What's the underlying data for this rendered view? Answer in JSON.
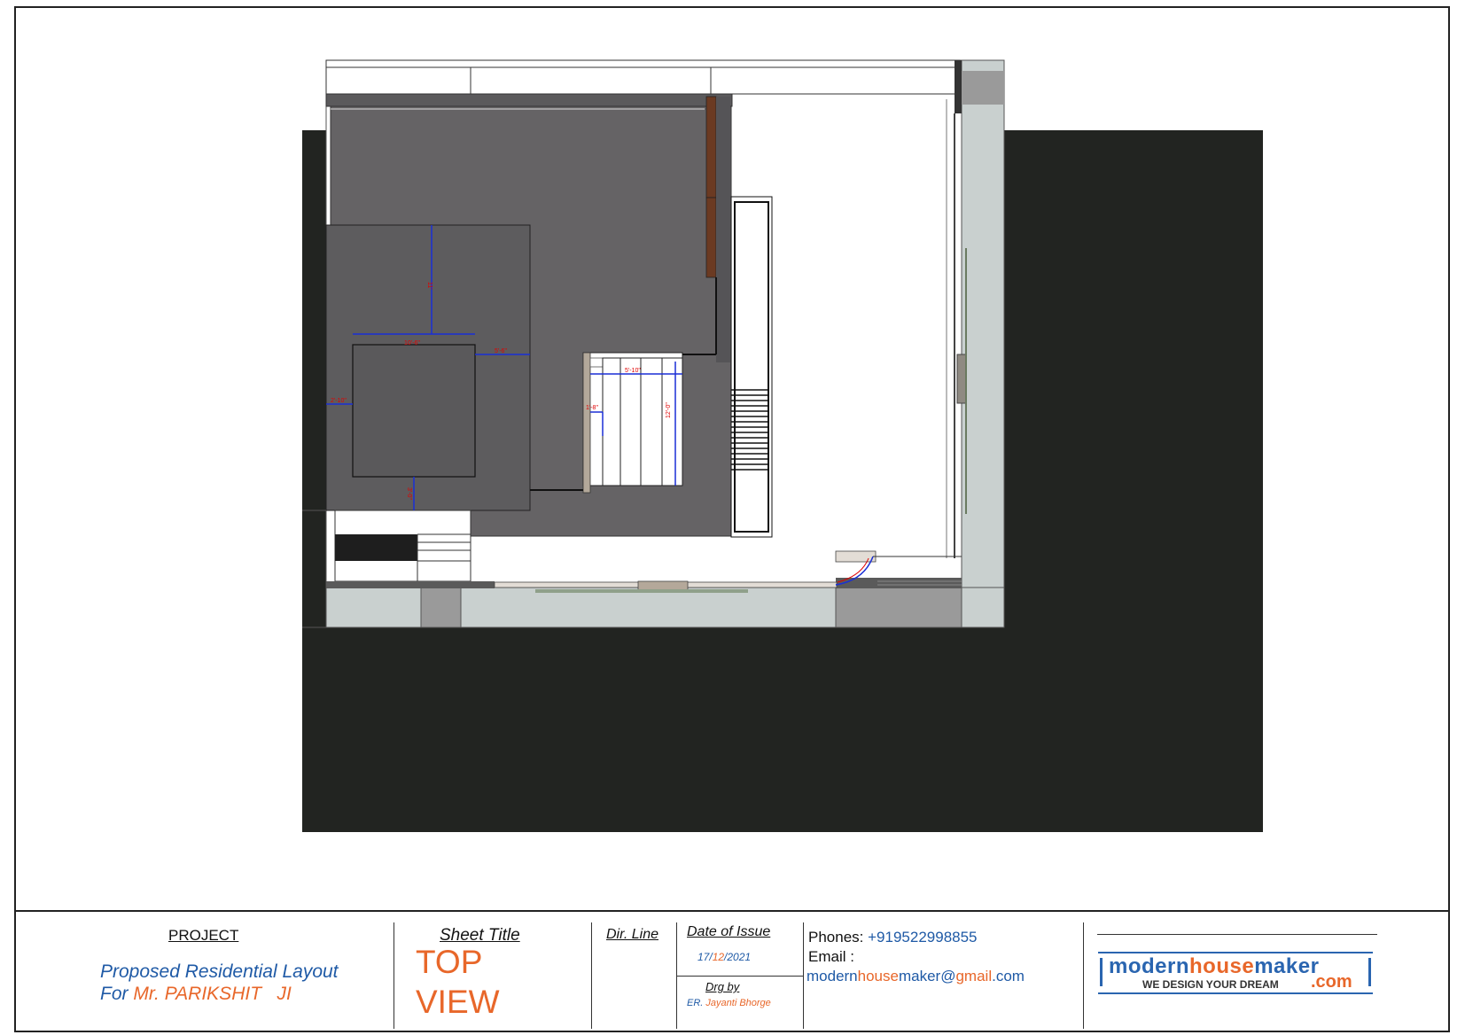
{
  "drawing": {
    "dimensions": {
      "d1": "11'",
      "d2": "10'-6\"",
      "d3": "5'-6\"",
      "d4": "2'-10\"",
      "d5": "3'-0\"",
      "d6": "5'-10\"",
      "d7": "1'-8\"",
      "d8": "12'-0\""
    },
    "colors": {
      "background_block": "#222421",
      "roof": "#656365",
      "wall": "#c9d0cf",
      "wall_dark": "#9a9a9a",
      "wood": "#6b3a22",
      "dimension_line": "#1a2fd6",
      "dimension_text": "#e00000"
    }
  },
  "title_block": {
    "project_label": "PROJECT",
    "project_line1": "Proposed Residential Layout",
    "project_line2_prefix": "For",
    "project_line2_name": "Mr. PARIKSHIT   JI",
    "sheet_title_label": "Sheet Title",
    "sheet_title_line1": "TOP",
    "sheet_title_line2": "VIEW",
    "dir_line_label": "Dir. Line",
    "date_label": "Date of Issue",
    "date_day": "17/",
    "date_month": "12",
    "date_year": "/2021",
    "drg_by_label": "Drg by",
    "drg_by_prefix": "ER.",
    "drg_by_name": "Jayanti Bhorge",
    "phones_label": "Phones:",
    "phone_number": "+919522998855",
    "email_label": "Email :",
    "email_part1": "modern",
    "email_part2": "house",
    "email_part3": "maker@",
    "email_part4": "gmail",
    "email_part5": ".com",
    "logo_part1": "modern",
    "logo_part2": "house",
    "logo_part3": "maker",
    "logo_tagline": "WE DESIGN YOUR DREAM",
    "logo_suffix": ".com",
    "colors": {
      "blue": "#1f5aa6",
      "orange": "#e8672a",
      "logo_blue": "#2a65b0"
    }
  }
}
